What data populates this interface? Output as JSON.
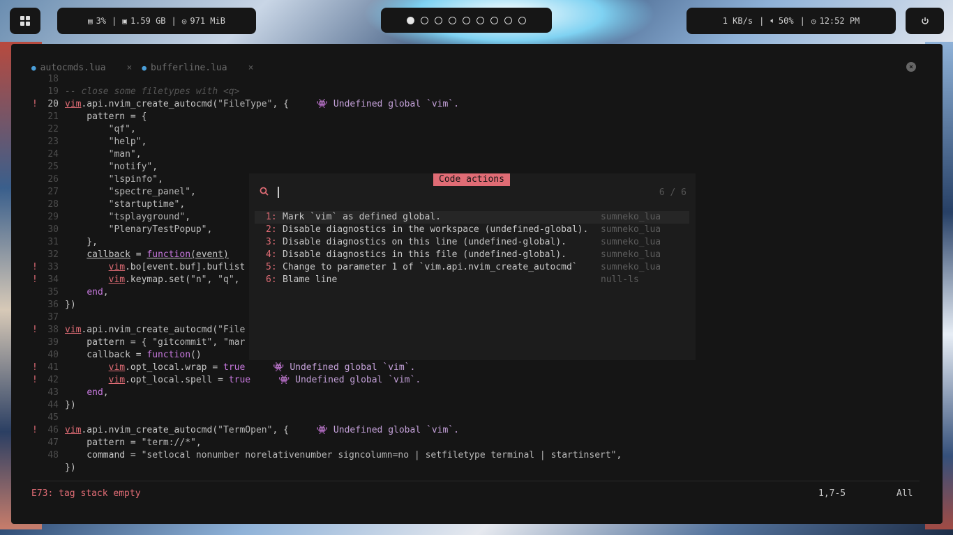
{
  "topbar": {
    "launcher_icon": "grid-icon",
    "cpu": "3%",
    "ram": "1.59 GB",
    "disk": "971 MiB",
    "separator": "|",
    "workspaces": [
      true,
      false,
      false,
      false,
      false,
      false,
      false,
      false,
      false
    ],
    "net": "1 KB/s",
    "volume": "50%",
    "clock": "12:52 PM",
    "power_icon": "power-icon"
  },
  "tabs": [
    {
      "label": "autocmds.lua",
      "close": "×"
    },
    {
      "label": "bufferline.lua",
      "close": "×"
    }
  ],
  "tab_close_all": "×",
  "editor": {
    "lines": [
      {
        "n": "18",
        "sign": "",
        "html": ""
      },
      {
        "n": "19",
        "sign": "",
        "html": "<span class=\"cm\">-- close some filetypes with &lt;q&gt;</span>"
      },
      {
        "n": "20",
        "sign": "!",
        "cur": true,
        "html": "<span class=\"g\">vim</span>.api.nvim_create_autocmd(<span class=\"s\">\"FileType\"</span>, {<span class=\"vt\">👾 Undefined global `vim`.</span>"
      },
      {
        "n": "21",
        "sign": "",
        "html": "    pattern = {"
      },
      {
        "n": "22",
        "sign": "",
        "html": "        <span class=\"s\">\"qf\"</span>,"
      },
      {
        "n": "23",
        "sign": "",
        "html": "        <span class=\"s\">\"help\"</span>,"
      },
      {
        "n": "24",
        "sign": "",
        "html": "        <span class=\"s\">\"man\"</span>,"
      },
      {
        "n": "25",
        "sign": "",
        "html": "        <span class=\"s\">\"notify\"</span>,"
      },
      {
        "n": "26",
        "sign": "",
        "html": "        <span class=\"s\">\"lspinfo\"</span>,"
      },
      {
        "n": "27",
        "sign": "",
        "html": "        <span class=\"s\">\"spectre_panel\"</span>,"
      },
      {
        "n": "28",
        "sign": "",
        "html": "        <span class=\"s\">\"startuptime\"</span>,"
      },
      {
        "n": "29",
        "sign": "",
        "html": "        <span class=\"s\">\"tsplayground\"</span>,"
      },
      {
        "n": "30",
        "sign": "",
        "html": "        <span class=\"s\">\"PlenaryTestPopup\"</span>,"
      },
      {
        "n": "31",
        "sign": "",
        "html": "    },"
      },
      {
        "n": "32",
        "sign": "",
        "html": "    <span class=\"ul\">callback</span> = <span class=\"ul\"><span class=\"k\">function</span>(event)</span>"
      },
      {
        "n": "33",
        "sign": "!",
        "html": "        <span class=\"g\">vim</span>.bo[event.buf].buflist"
      },
      {
        "n": "34",
        "sign": "!",
        "html": "        <span class=\"g\">vim</span>.keymap.set(<span class=\"s\">\"n\"</span>, <span class=\"s\">\"q\"</span>,                                                        `vim`."
      },
      {
        "n": "35",
        "sign": "",
        "html": "    <span class=\"k\">end</span>,"
      },
      {
        "n": "36",
        "sign": "",
        "html": "})"
      },
      {
        "n": "37",
        "sign": "",
        "html": ""
      },
      {
        "n": "38",
        "sign": "!",
        "html": "<span class=\"g\">vim</span>.api.nvim_create_autocmd(<span class=\"s\">\"File</span>"
      },
      {
        "n": "39",
        "sign": "",
        "html": "    pattern = { <span class=\"s\">\"gitcommit\"</span>, <span class=\"s\">\"mar</span>"
      },
      {
        "n": "40",
        "sign": "",
        "html": "    callback = <span class=\"k\">function</span>()"
      },
      {
        "n": "41",
        "sign": "!",
        "html": "        <span class=\"g\">vim</span>.opt_local.wrap = <span class=\"k\">true</span><span class=\"vt\">👾 Undefined global `vim`.</span>"
      },
      {
        "n": "42",
        "sign": "!",
        "html": "        <span class=\"g\">vim</span>.opt_local.spell = <span class=\"k\">true</span><span class=\"vt\">👾 Undefined global `vim`.</span>"
      },
      {
        "n": "43",
        "sign": "",
        "html": "    <span class=\"k\">end</span>,"
      },
      {
        "n": "44",
        "sign": "",
        "html": "})"
      },
      {
        "n": "45",
        "sign": "",
        "html": ""
      },
      {
        "n": "46",
        "sign": "!",
        "html": "<span class=\"g\">vim</span>.api.nvim_create_autocmd(<span class=\"s\">\"TermOpen\"</span>, {<span class=\"vt\">👾 Undefined global `vim`.</span>"
      },
      {
        "n": "47",
        "sign": "",
        "html": "    pattern = <span class=\"s\">\"term://*\"</span>,"
      },
      {
        "n": "48",
        "sign": "",
        "html": "    command = <span class=\"s\">\"setlocal nonumber norelativenumber signcolumn=no | setfiletype terminal | startinsert\"</span>,"
      },
      {
        "n": "",
        "sign": "",
        "html": "})"
      }
    ]
  },
  "popup": {
    "title": "Code actions",
    "count": "6 / 6",
    "items": [
      {
        "n": "1:",
        "text": "Mark `vim` as defined global.",
        "source": "sumneko_lua"
      },
      {
        "n": "2:",
        "text": "Disable diagnostics in the workspace (undefined-global).",
        "source": "sumneko_lua"
      },
      {
        "n": "3:",
        "text": "Disable diagnostics on this line (undefined-global).",
        "source": "sumneko_lua"
      },
      {
        "n": "4:",
        "text": "Disable diagnostics in this file (undefined-global).",
        "source": "sumneko_lua"
      },
      {
        "n": "5:",
        "text": "Change to parameter 1 of `vim.api.nvim_create_autocmd`",
        "source": "sumneko_lua"
      },
      {
        "n": "6:",
        "text": "Blame line",
        "source": "null-ls"
      }
    ]
  },
  "statusline": {
    "message": "E73: tag stack empty",
    "position": "1,7-5",
    "scroll": "All"
  }
}
